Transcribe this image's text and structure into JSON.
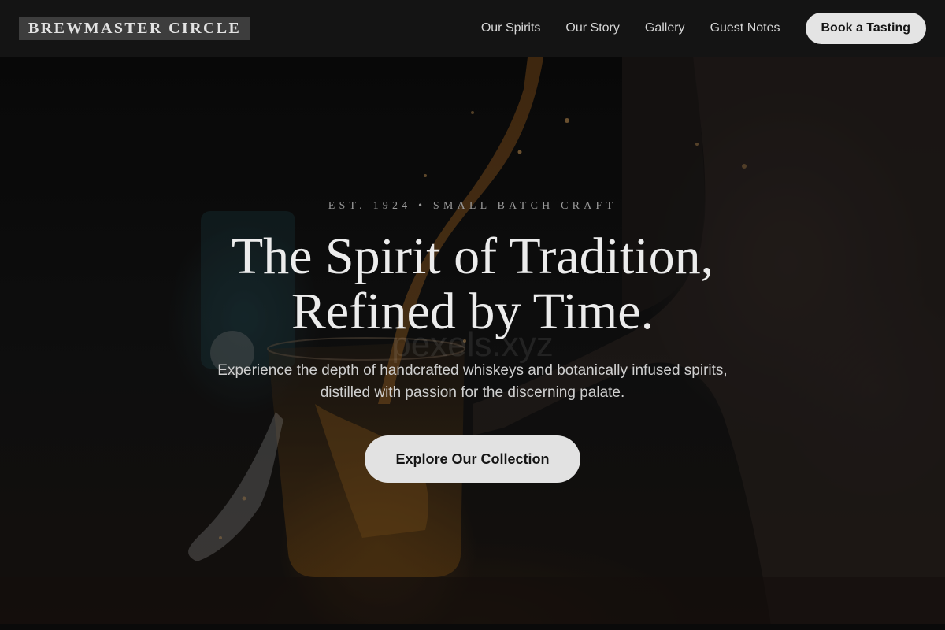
{
  "brand": {
    "name": "BREWMASTER CIRCLE"
  },
  "nav": {
    "links": [
      "Our Spirits",
      "Our Story",
      "Gallery",
      "Guest Notes"
    ],
    "cta_label": "Book a Tasting"
  },
  "hero": {
    "eyebrow": "EST. 1924 • SMALL BATCH CRAFT",
    "headline_line1": "The Spirit of Tradition,",
    "headline_line2": "Refined by Time.",
    "subcopy": "Experience the depth of handcrafted whiskeys and botanically infused spirits, distilled with passion for the discerning palate.",
    "cta_label": "Explore Our Collection",
    "image_watermark": "pexels.xyz"
  },
  "colors": {
    "nav_bg": "#141414",
    "button_bg": "#e4e4e4",
    "button_text": "#141414",
    "headline": "#ececec",
    "eyebrow": "#9a9a9a",
    "whiskey_amber": "#8a5a1c"
  }
}
